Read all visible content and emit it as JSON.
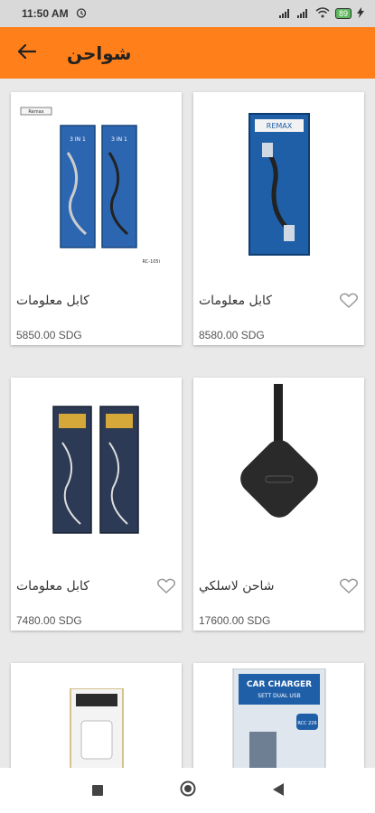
{
  "status": {
    "time": "11:50 AM",
    "battery": "89"
  },
  "app_bar": {
    "title": "شواحن"
  },
  "products": [
    {
      "name": "كابل معلومات",
      "price": "8580.00 SDG"
    },
    {
      "name": "كابل معلومات",
      "price": "5850.00 SDG"
    },
    {
      "name": "شاحن لاسلكي",
      "price": "17600.00 SDG"
    },
    {
      "name": "كابل معلومات",
      "price": "7480.00 SDG"
    },
    {
      "name": "",
      "price": ""
    },
    {
      "name": "",
      "price": ""
    }
  ],
  "images": {
    "p1_header": "Remax",
    "p1_model": "RC-105i",
    "p2_brand": "REMAX",
    "p2_label": "3 IN 1",
    "p2_model": "RC-109th",
    "p6_line1": "CAR CHARGER",
    "p6_line2": "SETT DUAL USB",
    "p6_model": "RCC 226"
  },
  "colors": {
    "accent": "#ff7f1a",
    "status_bar": "#d9d9d9"
  }
}
